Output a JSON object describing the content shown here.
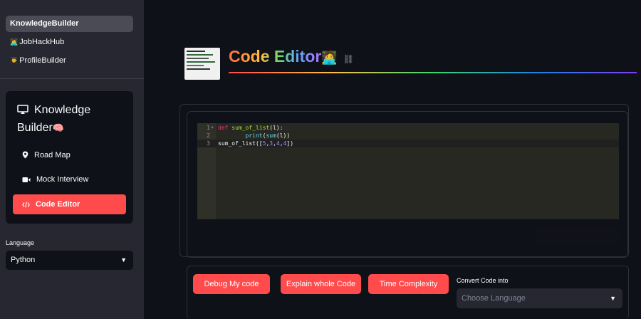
{
  "app_nav": [
    {
      "label": "KnowledgeBuilder",
      "emoji": ""
    },
    {
      "label": "JobHackHub",
      "emoji": "👩‍💻"
    },
    {
      "label": "ProfileBuilder",
      "emoji": "👨‍🎓"
    }
  ],
  "menu": {
    "title_line1": "Knowledge",
    "title_line2": "Builder",
    "title_emoji": "🧠",
    "items": [
      {
        "label": "Road Map",
        "icon": "map-pin-icon"
      },
      {
        "label": "Mock Interview",
        "icon": "video-camera-icon"
      },
      {
        "label": "Code Editor",
        "icon": "code-icon"
      }
    ]
  },
  "language": {
    "label": "Language",
    "value": "Python"
  },
  "page": {
    "title": "Code Editor",
    "title_emoji": "🧑‍💻",
    "link_icon": "⛓"
  },
  "editor": {
    "lines": [
      {
        "n": "1",
        "fold": "▾"
      },
      {
        "n": "2",
        "fold": ""
      },
      {
        "n": "3",
        "fold": ""
      }
    ]
  },
  "buttons": {
    "debug": "Debug My code",
    "explain": "Explain whole Code",
    "complexity": "Time Complexity"
  },
  "convert": {
    "label": "Convert Code into",
    "placeholder": "Choose Language"
  },
  "colors": {
    "accent": "#ff4b4b",
    "sidebar": "#262730",
    "background": "#0e1117",
    "editor_bg": "#272822"
  }
}
